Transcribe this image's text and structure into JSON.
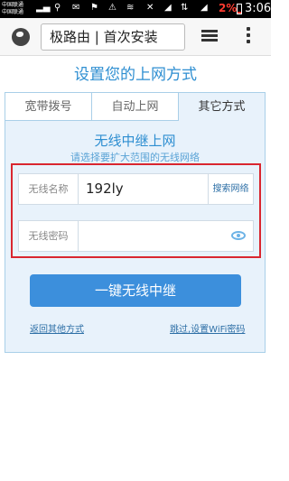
{
  "status_bar": {
    "carrier_1": "中国联通",
    "carrier_2": "中国联通",
    "battery_text": "2%",
    "time": "3:06",
    "battery_level": 0.02
  },
  "app_bar": {
    "url_text": "极路由 | 首次安装"
  },
  "page": {
    "title": "设置您的上网方式",
    "tabs": [
      {
        "label": "宽带拨号"
      },
      {
        "label": "自动上网"
      },
      {
        "label": "其它方式"
      }
    ],
    "section_title": "无线中继上网",
    "section_subtitle": "请选择要扩大范围的无线网络",
    "wifi_name": {
      "label": "无线名称",
      "value": "192ly",
      "button": "搜索网络"
    },
    "wifi_password": {
      "label": "无线密码",
      "value": ""
    },
    "primary_button": "一键无线中继",
    "link_back": "返回其他方式",
    "link_skip": "跳过,设置WiFi密码"
  },
  "colors": {
    "accent": "#2d8ed1",
    "button": "#3c8fdc",
    "highlight_border": "#d9262f",
    "card_bg": "#e8f2fb"
  }
}
